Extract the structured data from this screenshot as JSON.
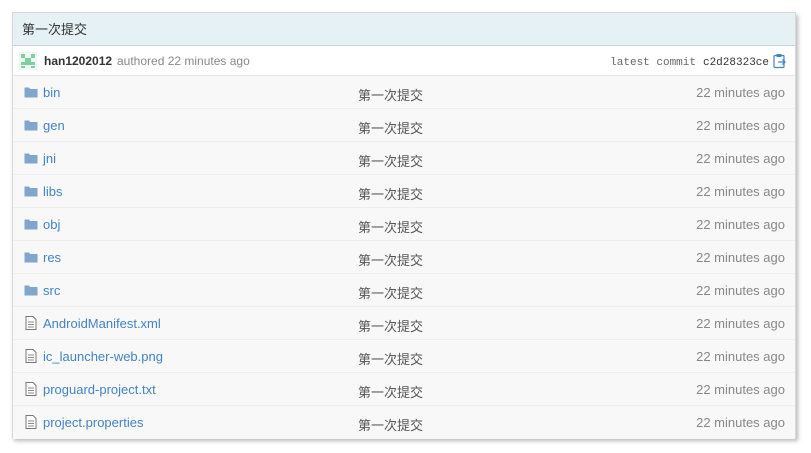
{
  "commit": {
    "message": "第一次提交",
    "author": "han1202012",
    "authored_text": "authored 22 minutes ago",
    "latest_commit_label": "latest commit",
    "sha": "c2d28323ce"
  },
  "colors": {
    "link": "#4183c4",
    "header_bg": "#e6f1f6",
    "row_bg": "#f8f8f8",
    "folder_icon": "#80a6cd",
    "avatar": "#7fd1a2"
  },
  "files": [
    {
      "name": "bin",
      "type": "folder",
      "icon": "folder-icon",
      "message": "第一次提交",
      "age": "22 minutes ago"
    },
    {
      "name": "gen",
      "type": "folder",
      "icon": "folder-icon",
      "message": "第一次提交",
      "age": "22 minutes ago"
    },
    {
      "name": "jni",
      "type": "folder",
      "icon": "folder-icon",
      "message": "第一次提交",
      "age": "22 minutes ago"
    },
    {
      "name": "libs",
      "type": "folder",
      "icon": "folder-icon",
      "message": "第一次提交",
      "age": "22 minutes ago"
    },
    {
      "name": "obj",
      "type": "folder",
      "icon": "folder-icon",
      "message": "第一次提交",
      "age": "22 minutes ago"
    },
    {
      "name": "res",
      "type": "folder",
      "icon": "folder-icon",
      "message": "第一次提交",
      "age": "22 minutes ago"
    },
    {
      "name": "src",
      "type": "folder",
      "icon": "folder-icon",
      "message": "第一次提交",
      "age": "22 minutes ago"
    },
    {
      "name": "AndroidManifest.xml",
      "type": "file",
      "icon": "file-icon",
      "message": "第一次提交",
      "age": "22 minutes ago"
    },
    {
      "name": "ic_launcher-web.png",
      "type": "file",
      "icon": "file-icon",
      "message": "第一次提交",
      "age": "22 minutes ago"
    },
    {
      "name": "proguard-project.txt",
      "type": "file",
      "icon": "file-icon",
      "message": "第一次提交",
      "age": "22 minutes ago"
    },
    {
      "name": "project.properties",
      "type": "file",
      "icon": "file-icon",
      "message": "第一次提交",
      "age": "22 minutes ago"
    }
  ]
}
